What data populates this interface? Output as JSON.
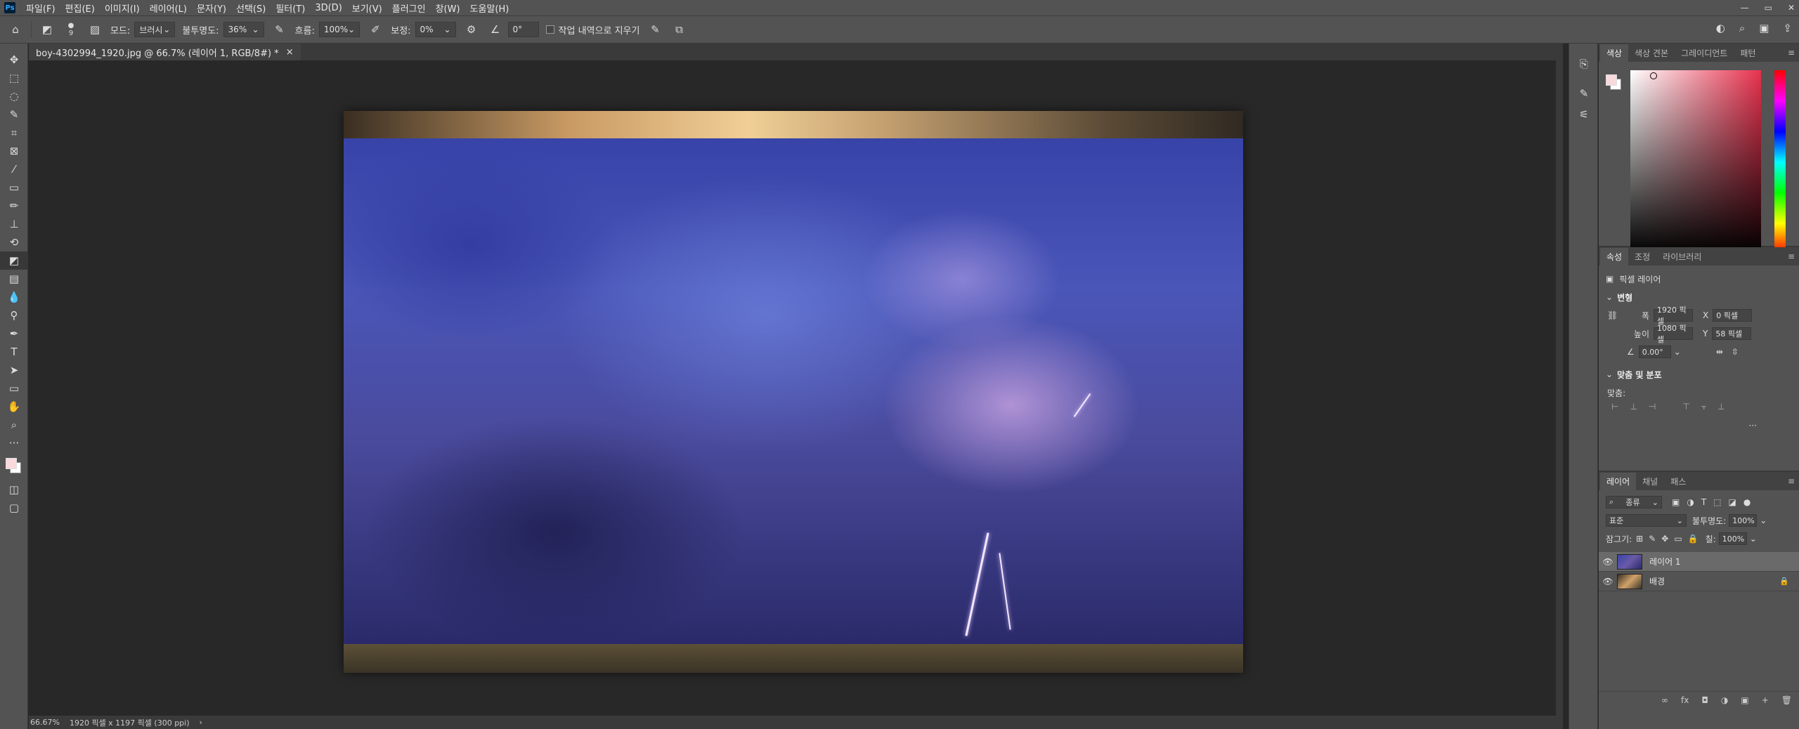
{
  "menubar": {
    "items": [
      "파일(F)",
      "편집(E)",
      "이미지(I)",
      "레이어(L)",
      "문자(Y)",
      "선택(S)",
      "필터(T)",
      "3D(D)",
      "보기(V)",
      "플러그인",
      "창(W)",
      "도움말(H)"
    ],
    "window_controls": [
      "—",
      "▭",
      "✕"
    ]
  },
  "options": {
    "brush_size": "9",
    "mode_label": "모드:",
    "mode_value": "브러시",
    "opacity_label": "불투명도:",
    "opacity_value": "36%",
    "flow_label": "흐름:",
    "flow_value": "100%",
    "smoothing_label": "보정:",
    "smoothing_value": "0%",
    "angle_value": "0°",
    "erase_history_label": "작업 내역으로 지우기"
  },
  "document": {
    "tab_title": "boy-4302994_1920.jpg @ 66.7% (레이어 1, RGB/8#) *",
    "tab_close": "×"
  },
  "status": {
    "zoom": "66.67%",
    "info": "1920 픽셀 x 1197 픽셀 (300 ppi)",
    "arrow": "›"
  },
  "color_panel": {
    "tabs": [
      "색상",
      "색상 견본",
      "그레이디언트",
      "패턴"
    ],
    "foreground": "#f9d9dc",
    "background": "#ffffff"
  },
  "properties": {
    "tabs": [
      "속성",
      "조정",
      "라이브러리"
    ],
    "layer_type": "픽셀 레이어",
    "transform_header": "변형",
    "width_label": "폭",
    "width_value": "1920 픽셀",
    "x_label": "X",
    "x_value": "0 픽셀",
    "height_label": "높이",
    "height_value": "1080 픽셀",
    "y_label": "Y",
    "y_value": "58 픽셀",
    "angle_value": "0.00°",
    "align_header": "맞춤 및 분포",
    "align_label": "맞춤:",
    "more": "···"
  },
  "layers": {
    "tabs": [
      "레이어",
      "채널",
      "패스"
    ],
    "filter_value": "종류",
    "blend_mode": "표준",
    "opacity_label": "불투명도:",
    "opacity_value": "100%",
    "lock_label": "잠그기:",
    "fill_label": "칠:",
    "fill_value": "100%",
    "items": [
      {
        "name": "레이어 1",
        "visible": "👁",
        "lock": ""
      },
      {
        "name": "배경",
        "visible": "👁",
        "lock": "🔒"
      }
    ],
    "footer_icons": [
      "∞",
      "fx",
      "◘",
      "◑",
      "▣",
      "+",
      "🗑"
    ]
  },
  "toolbar": {
    "tools": [
      "move-tool",
      "marquee-tool",
      "lasso-tool",
      "quick-select-tool",
      "crop-tool",
      "frame-tool",
      "eyedropper-tool",
      "healing-tool",
      "brush-tool",
      "stamp-tool",
      "history-brush-tool",
      "eraser-tool",
      "gradient-tool",
      "blur-tool",
      "dodge-tool",
      "pen-tool",
      "type-tool",
      "path-select-tool",
      "shape-tool",
      "hand-tool",
      "zoom-tool",
      "more-tools"
    ]
  }
}
